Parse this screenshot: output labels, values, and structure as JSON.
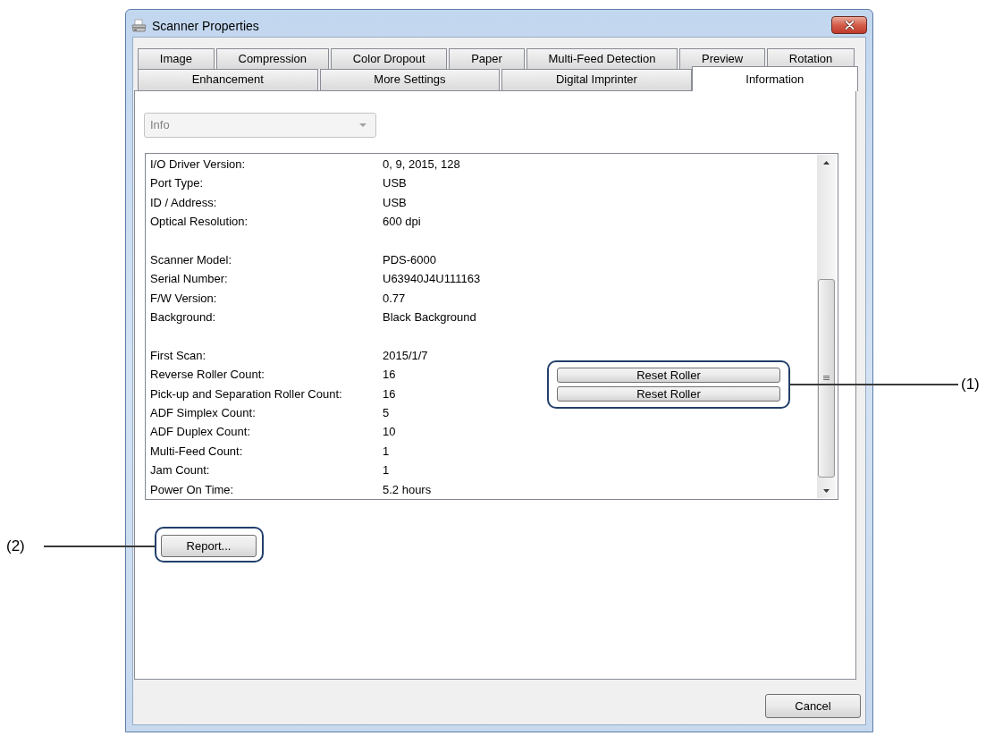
{
  "window": {
    "title": "Scanner Properties"
  },
  "tab_rows": [
    {
      "tabs": [
        {
          "label": "Image",
          "selected": false
        },
        {
          "label": "Compression",
          "selected": false
        },
        {
          "label": "Color Dropout",
          "selected": false
        },
        {
          "label": "Paper",
          "selected": false
        },
        {
          "label": "Multi-Feed Detection",
          "selected": false
        },
        {
          "label": "Preview",
          "selected": false
        },
        {
          "label": "Rotation",
          "selected": false
        }
      ]
    },
    {
      "tabs": [
        {
          "label": "Enhancement",
          "selected": false
        },
        {
          "label": "More Settings",
          "selected": false
        },
        {
          "label": "Digital Imprinter",
          "selected": false
        },
        {
          "label": "Information",
          "selected": true
        }
      ]
    }
  ],
  "info_panel": {
    "dropdown": {
      "value": "Info",
      "disabled": true
    },
    "info_list": {
      "callout": "(1)",
      "groups": [
        {
          "rows": [
            {
              "label": "I/O Driver Version:",
              "value": "0, 9, 2015, 128"
            },
            {
              "label": "Port Type:",
              "value": "USB"
            },
            {
              "label": "ID / Address:",
              "value": "USB"
            },
            {
              "label": "Optical Resolution:",
              "value": "600 dpi"
            }
          ]
        },
        {
          "rows": [
            {
              "label": "Scanner Model:",
              "value": "PDS-6000"
            },
            {
              "label": "Serial Number:",
              "value": "U63940J4U111163"
            },
            {
              "label": "F/W Version:",
              "value": "0.77"
            },
            {
              "label": "Background:",
              "value": "Black Background"
            }
          ]
        },
        {
          "rows": [
            {
              "label": "First Scan:",
              "value": "2015/1/7"
            },
            {
              "label": "Reverse Roller Count:",
              "value": "16",
              "button": "Reset Roller"
            },
            {
              "label": "Pick-up and Separation Roller Count:",
              "value": "16",
              "button": "Reset Roller"
            },
            {
              "label": "ADF Simplex Count:",
              "value": "5"
            },
            {
              "label": "ADF Duplex Count:",
              "value": "10"
            },
            {
              "label": "Multi-Feed Count:",
              "value": "1"
            },
            {
              "label": "Jam Count:",
              "value": "1"
            },
            {
              "label": "Power On Time:",
              "value": "5.2 hours"
            }
          ]
        }
      ]
    },
    "report_button": {
      "label": "Report...",
      "callout": "(2)"
    }
  },
  "dialog_buttons": [
    {
      "label": "Cancel"
    }
  ]
}
